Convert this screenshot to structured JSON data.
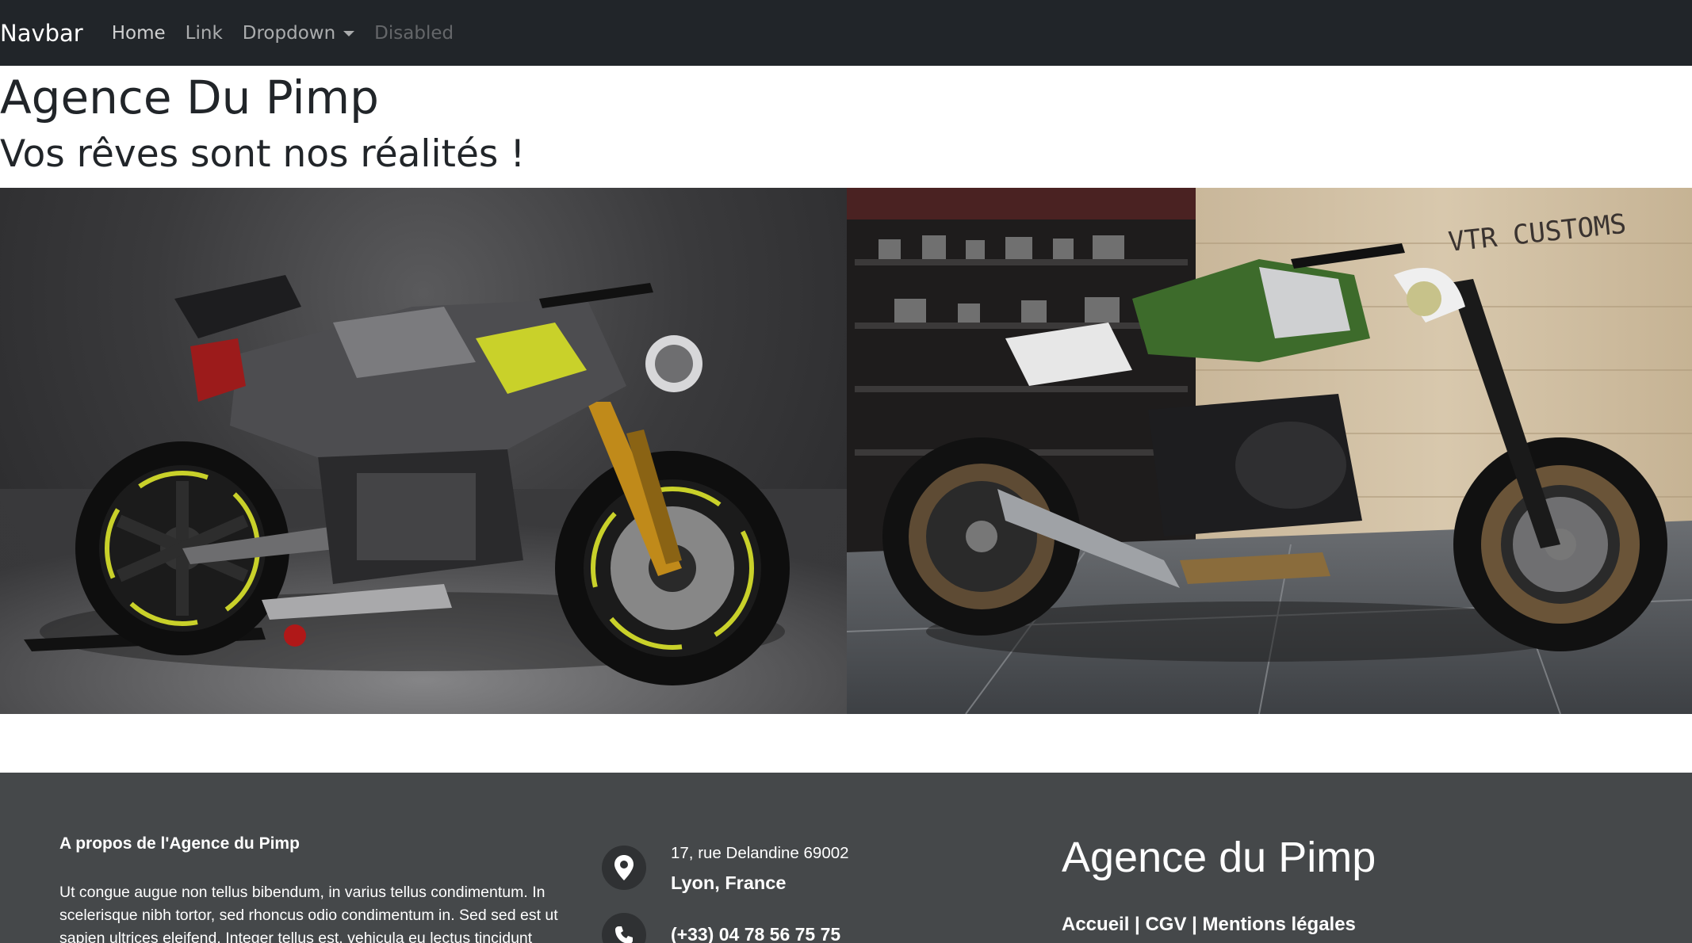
{
  "navbar": {
    "brand": "Navbar",
    "links": [
      "Home",
      "Link",
      "Dropdown",
      "Disabled"
    ]
  },
  "hero": {
    "title": "Agence Du Pimp",
    "subtitle": "Vos rêves sont nos réalités !"
  },
  "gallery": {
    "right_sign": "VTR CUSTOMS"
  },
  "footer": {
    "about_title": "A propos de l'Agence du Pimp",
    "about_text": "Ut congue augue non tellus bibendum, in varius tellus condimentum. In scelerisque nibh tortor, sed rhoncus odio condimentum in. Sed sed est ut sapien ultrices eleifend. Integer tellus est, vehicula eu lectus tincidunt",
    "address_line1": "17, rue Delandine 69002",
    "address_line2": "Lyon, France",
    "phone": "(+33) 04 78 56 75 75",
    "brand": "Agence du Pimp",
    "links": [
      "Accueil",
      "CGV",
      "Mentions légales"
    ],
    "link_separator": " | ",
    "icons": [
      "map-pin-icon",
      "phone-icon"
    ]
  },
  "colors": {
    "navbar_bg": "#212529",
    "footer_bg": "#45484a",
    "icon_circle_bg": "#2f3133"
  }
}
